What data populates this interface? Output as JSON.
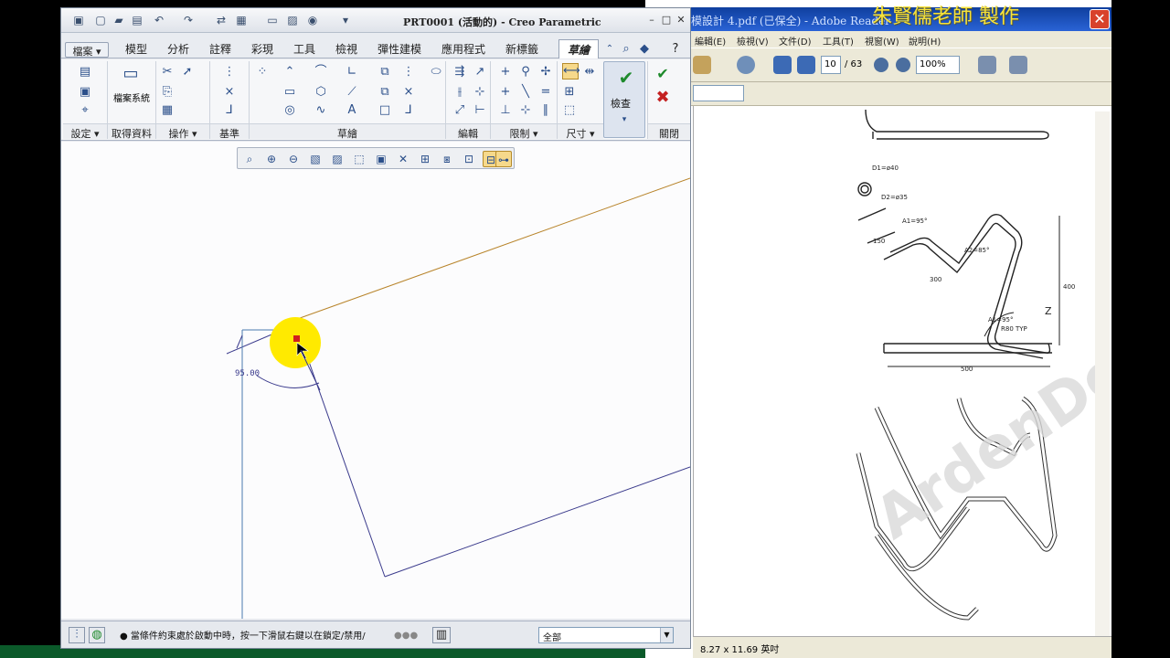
{
  "creo": {
    "title": "PRT0001 (活動的) - Creo Parametric",
    "tabs": [
      "檔案 ▾",
      "模型",
      "分析",
      "註釋",
      "彩現",
      "工具",
      "檢視",
      "彈性建模",
      "應用程式",
      "新標籤",
      "草繪"
    ],
    "ribbon": {
      "file_system_label": "檔案系統",
      "check_label": "檢查",
      "groups": [
        "設定 ▾",
        "取得資料",
        "操作 ▾",
        "基準",
        "草繪",
        "編輯",
        "限制 ▾",
        "尺寸 ▾",
        "關閉"
      ]
    },
    "sketch": {
      "dimension_text": "95.00"
    },
    "status": {
      "message": "● 當條件約束處於啟動中時，按一下滑鼠右鍵以在鎖定/禁用/",
      "filter": "全部"
    }
  },
  "reader": {
    "title": "模設計 4.pdf (已保全) - Adobe Reader",
    "promo_text": "朱賢儒老師 製作",
    "menu": [
      "編輯(E)",
      "檢視(V)",
      "文件(D)",
      "工具(T)",
      "視窗(W)",
      "說明(H)"
    ],
    "page_current": "10",
    "page_total": "/ 63",
    "zoom": "100%",
    "page_size": "8.27 x 11.69 英吋",
    "watermark": "ArdenDesi",
    "drawing_labels": [
      "D1=ø40",
      "D2=ø35",
      "A1=95°",
      "A2=85°",
      "300",
      "400",
      "150",
      "A1=95°",
      "R80 TYP",
      "500",
      "Z"
    ]
  },
  "colors": {
    "sketch_line": "#3a3a8c",
    "reference_line": "#b8842a",
    "highlight": "#ffea00",
    "selected_point": "#d01f1f"
  }
}
